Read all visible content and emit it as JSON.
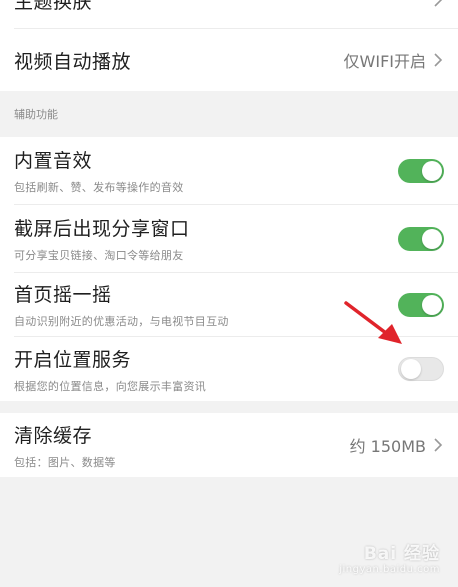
{
  "settings": {
    "top_partial": {
      "title": "主题换肤"
    },
    "video_autoplay": {
      "title": "视频自动播放",
      "value": "仅WIFI开启"
    },
    "section_label": "辅助功能",
    "sound_effects": {
      "title": "内置音效",
      "subtitle": "包括刷新、赞、发布等操作的音效",
      "enabled": true
    },
    "screenshot_share": {
      "title": "截屏后出现分享窗口",
      "subtitle": "可分享宝贝链接、淘口令等给朋友",
      "enabled": true
    },
    "shake": {
      "title": "首页摇一摇",
      "subtitle": "自动识别附近的优惠活动，与电视节目互动",
      "enabled": true
    },
    "location": {
      "title": "开启位置服务",
      "subtitle": "根据您的位置信息，向您展示丰富资讯",
      "enabled": false
    },
    "clear_cache": {
      "title": "清除缓存",
      "subtitle": "包括：图片、数据等",
      "value": "约 150MB"
    }
  },
  "watermark": {
    "main": "Bai 经验",
    "sub": "jingyan.baidu.com"
  },
  "colors": {
    "toggle_on": "#52b35a",
    "toggle_off": "#e8e8e8",
    "arrow": "#e0242b"
  }
}
